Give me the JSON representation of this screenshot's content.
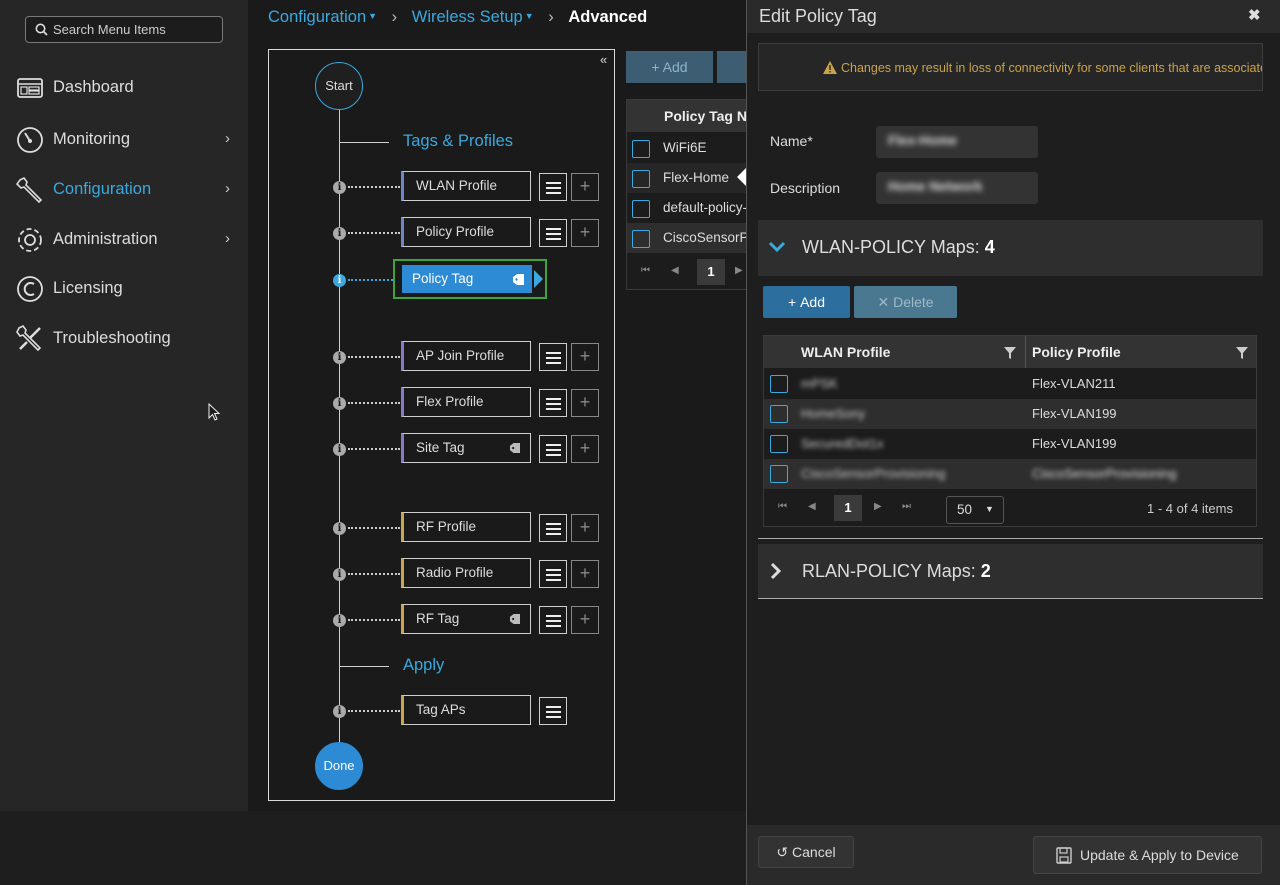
{
  "search": {
    "placeholder": "Search Menu Items"
  },
  "nav": [
    {
      "label": "Dashboard",
      "icon": "dashboard-icon"
    },
    {
      "label": "Monitoring",
      "icon": "gauge-icon"
    },
    {
      "label": "Configuration",
      "icon": "wrench-icon",
      "active": true
    },
    {
      "label": "Administration",
      "icon": "gear-icon"
    },
    {
      "label": "Licensing",
      "icon": "copyright-icon"
    },
    {
      "label": "Troubleshooting",
      "icon": "tools-icon"
    }
  ],
  "breadcrumb": {
    "item1": "Configuration",
    "item2": "Wireless Setup",
    "current": "Advanced"
  },
  "flow": {
    "start": "Start",
    "done": "Done",
    "section_tags": "Tags & Profiles",
    "section_apply": "Apply",
    "items": {
      "wlan_profile": "WLAN Profile",
      "policy_profile": "Policy Profile",
      "policy_tag": "Policy Tag",
      "ap_join_profile": "AP Join Profile",
      "flex_profile": "Flex Profile",
      "site_tag": "Site Tag",
      "rf_profile": "RF Profile",
      "radio_profile": "Radio Profile",
      "rf_tag": "RF Tag",
      "tag_aps": "Tag APs"
    }
  },
  "policy_table": {
    "add_label": "+ Add",
    "header": "Policy Tag Name",
    "rows": [
      "WiFi6E",
      "Flex-Home",
      "default-policy-tag",
      "CiscoSensorProvisioning"
    ],
    "page": "1"
  },
  "dialog": {
    "title": "Edit Policy Tag",
    "warning": "Changes may result in loss of connectivity for some clients that are associated to APs with this Policy Tag.",
    "name_label": "Name*",
    "name_value": "Flex-Home",
    "description_label": "Description",
    "description_value": "Home Network",
    "wlan_section_label": "WLAN-POLICY Maps:",
    "wlan_section_count": "4",
    "add_label": "Add",
    "delete_label": "Delete",
    "col_wlan": "WLAN Profile",
    "col_policy": "Policy Profile",
    "rows": [
      {
        "wlan": "mPSK",
        "policy": "Flex-VLAN211",
        "policy_blurred": false
      },
      {
        "wlan": "HomeSony",
        "policy": "Flex-VLAN199",
        "policy_blurred": false
      },
      {
        "wlan": "SecuredDot1x",
        "policy": "Flex-VLAN199",
        "policy_blurred": false
      },
      {
        "wlan": "CiscoSensorProvisioning",
        "policy": "CiscoSensorProvisioning",
        "policy_blurred": true
      }
    ],
    "page": "1",
    "per_page": "50",
    "items_count": "1 - 4 of 4 items",
    "rlan_section_label": "RLAN-POLICY Maps:",
    "rlan_section_count": "2",
    "cancel_label": "Cancel",
    "apply_label": "Update & Apply to Device"
  },
  "colors": {
    "accent": "#39a9e0",
    "active_green": "#3fa43f",
    "primary_button": "#2c6f9e",
    "warning": "#c9a34a"
  }
}
